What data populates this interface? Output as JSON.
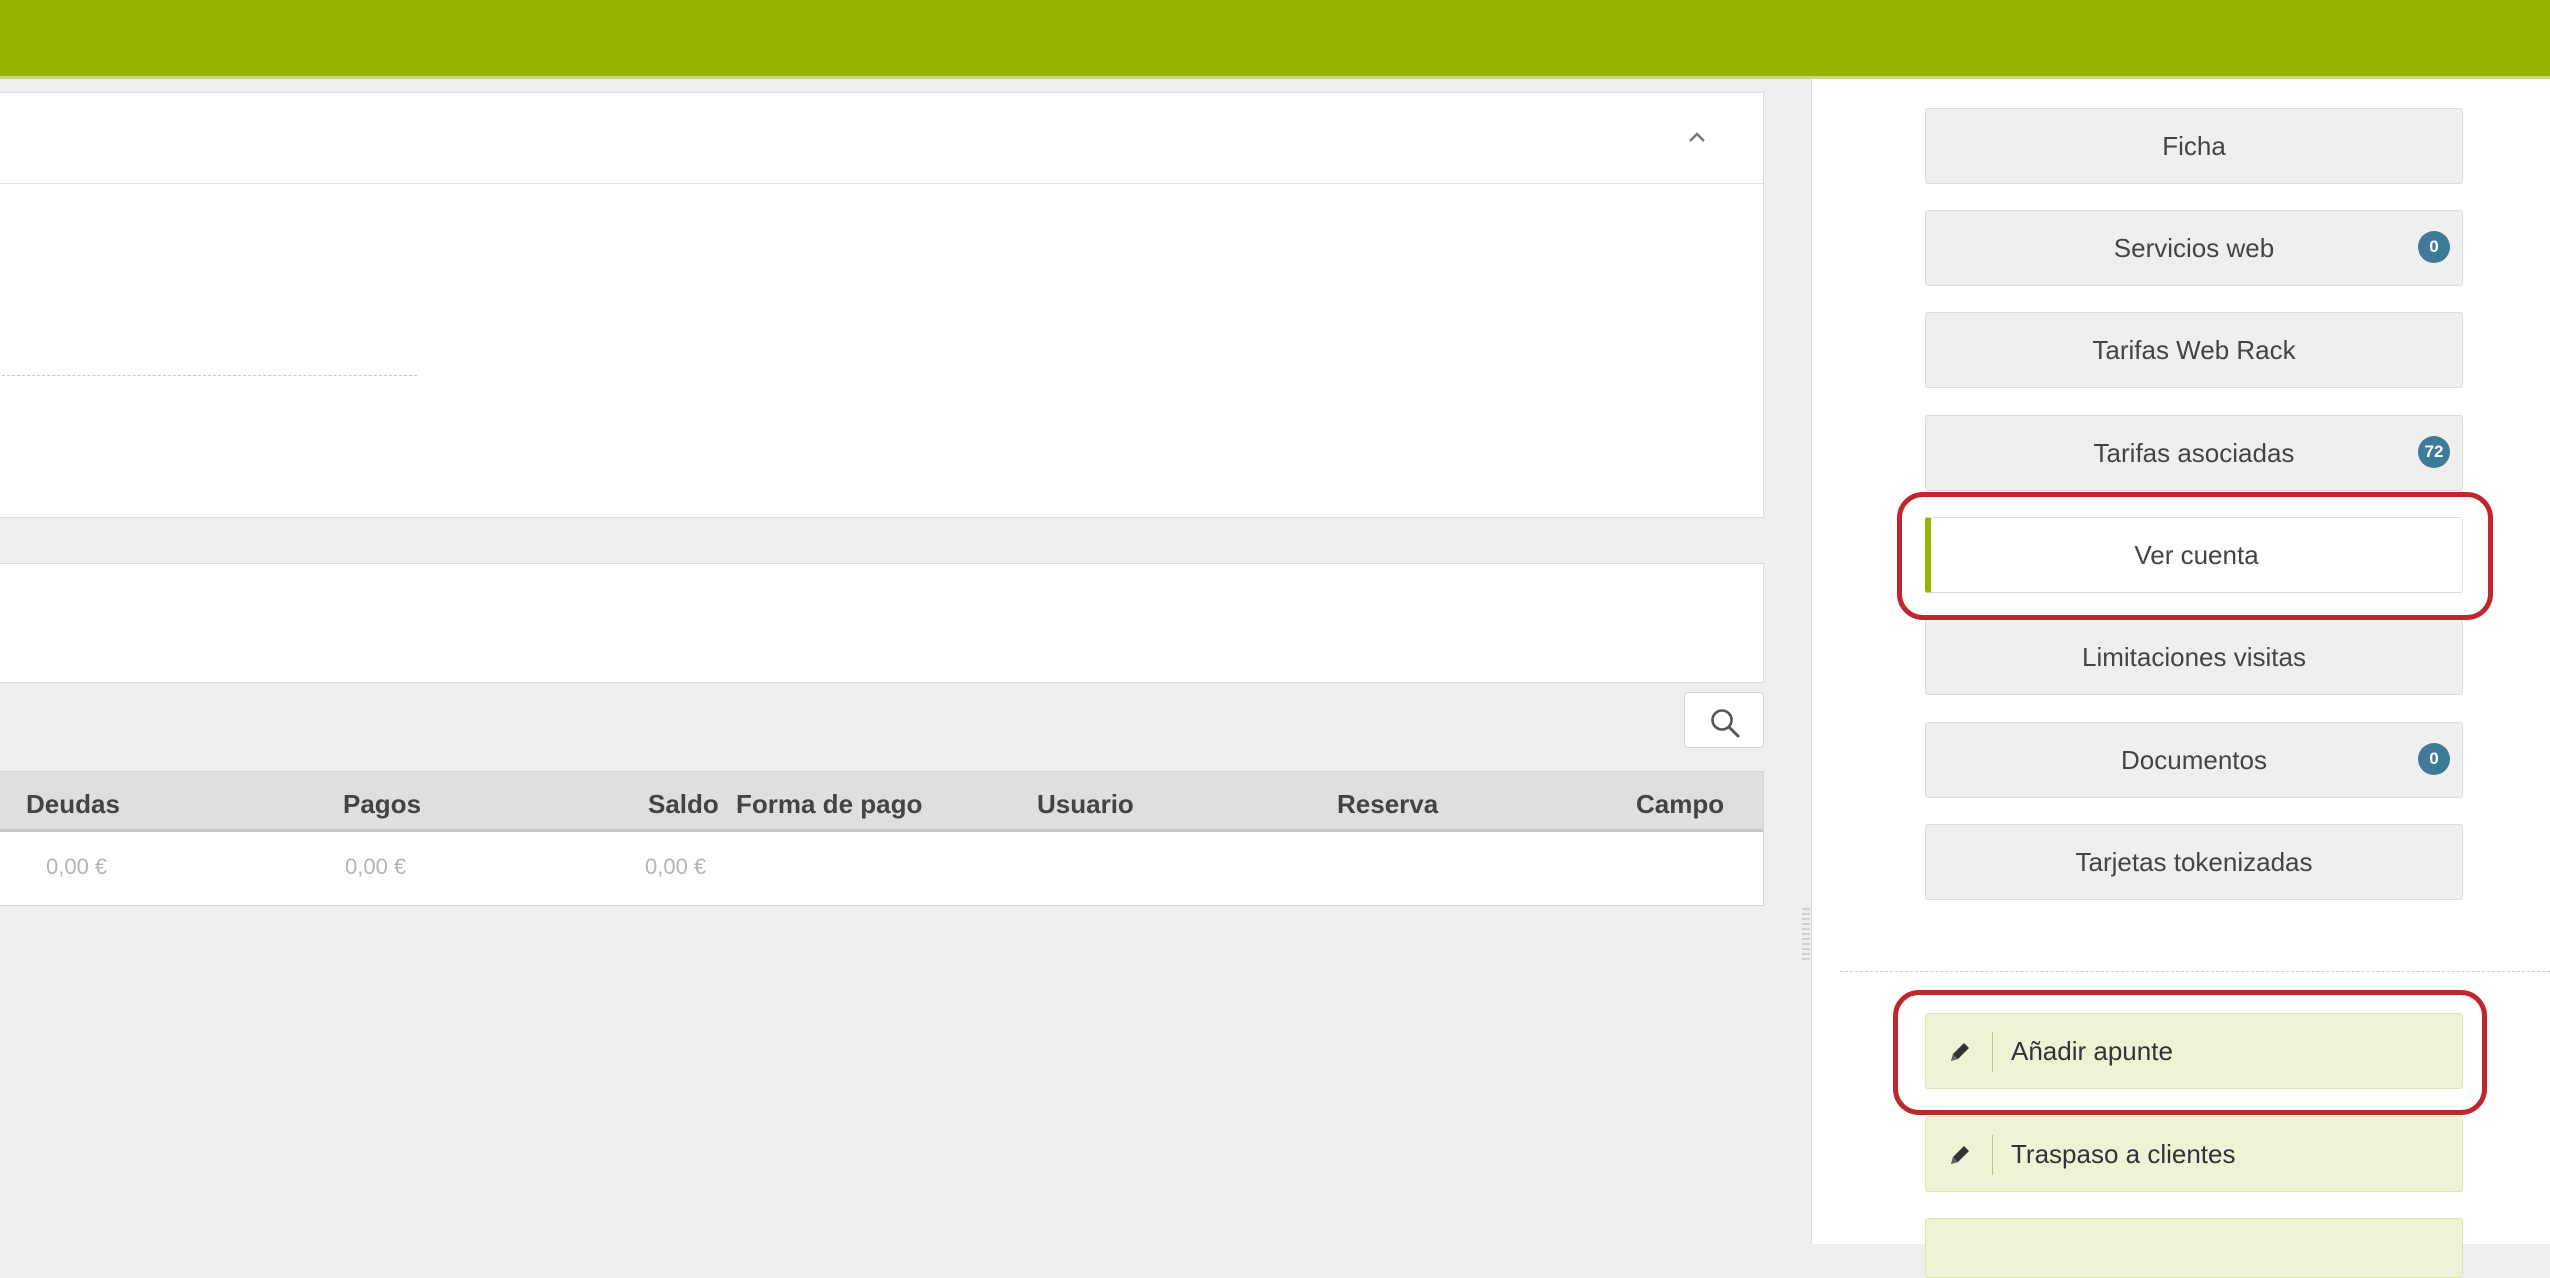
{
  "table": {
    "headers": {
      "deudas": "Deudas",
      "pagos": "Pagos",
      "saldo": "Saldo",
      "forma_pago": "Forma de pago",
      "usuario": "Usuario",
      "reserva": "Reserva",
      "campo": "Campo"
    },
    "row": {
      "deudas": "0,00 €",
      "pagos": "0,00 €",
      "saldo": "0,00 €"
    }
  },
  "sidebar": {
    "nav": [
      {
        "label": "Ficha"
      },
      {
        "label": "Servicios web",
        "badge": "0"
      },
      {
        "label": "Tarifas Web Rack"
      },
      {
        "label": "Tarifas asociadas",
        "badge": "72"
      },
      {
        "label": "Ver cuenta",
        "active": true
      },
      {
        "label": "Limitaciones visitas"
      },
      {
        "label": "Documentos",
        "badge": "0"
      },
      {
        "label": "Tarjetas tokenizadas"
      }
    ],
    "actions": [
      {
        "label": "Añadir apunte"
      },
      {
        "label": "Traspaso a clientes"
      }
    ]
  },
  "colors": {
    "brand": "#9ab100",
    "badge": "#3f7a9a",
    "highlight": "#c0272d",
    "action_bg": "#eef3d6"
  },
  "icons": {
    "collapse": "chevron-up-icon",
    "search": "search-icon",
    "action": "pencil-icon"
  }
}
